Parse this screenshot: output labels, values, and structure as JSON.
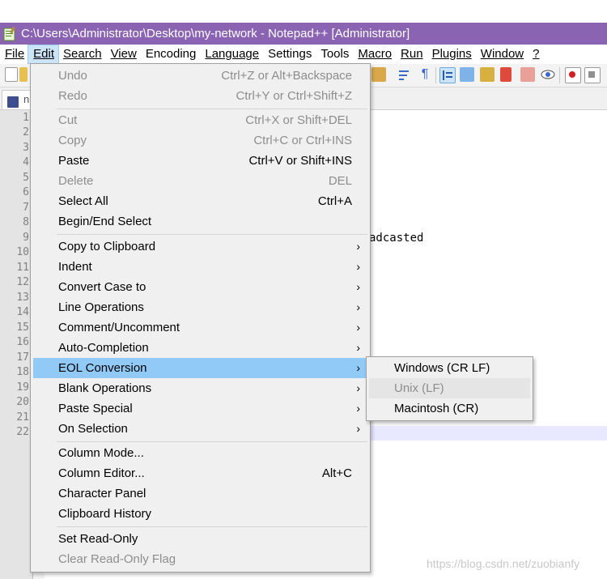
{
  "window": {
    "title": "C:\\Users\\Administrator\\Desktop\\my-network - Notepad++ [Administrator]"
  },
  "menubar": {
    "items": [
      {
        "label": "File",
        "key": "F"
      },
      {
        "label": "Edit",
        "key": "E"
      },
      {
        "label": "Search",
        "key": "S"
      },
      {
        "label": "View",
        "key": "V"
      },
      {
        "label": "Encoding",
        "key": "n"
      },
      {
        "label": "Language",
        "key": "L"
      },
      {
        "label": "Settings",
        "key": "t"
      },
      {
        "label": "Tools",
        "key": "o"
      },
      {
        "label": "Macro",
        "key": "M"
      },
      {
        "label": "Run",
        "key": "R"
      },
      {
        "label": "Plugins",
        "key": "P"
      },
      {
        "label": "Window",
        "key": "W"
      },
      {
        "label": "?",
        "key": "?"
      }
    ],
    "active": "Edit"
  },
  "tab": {
    "label_fragment": "n"
  },
  "editor": {
    "line_numbers": [
      "1",
      "2",
      "3",
      "4",
      "5",
      "6",
      "7",
      "8",
      "9",
      "10",
      "11",
      "12",
      "13",
      "14",
      "15",
      "16",
      "17",
      "18",
      "19",
      "20",
      "21",
      "22"
    ],
    "visible_text_line9": "adcasted",
    "current_line": 22
  },
  "edit_menu": {
    "items": [
      {
        "label": "Undo",
        "shortcut": "Ctrl+Z or Alt+Backspace",
        "disabled": true
      },
      {
        "label": "Redo",
        "shortcut": "Ctrl+Y or Ctrl+Shift+Z",
        "disabled": true
      },
      {
        "label": "Cut",
        "shortcut": "Ctrl+X or Shift+DEL",
        "disabled": true
      },
      {
        "label": "Copy",
        "shortcut": "Ctrl+C or Ctrl+INS",
        "disabled": true
      },
      {
        "label": "Paste",
        "shortcut": "Ctrl+V or Shift+INS",
        "disabled": false
      },
      {
        "label": "Delete",
        "shortcut": "DEL",
        "disabled": true
      },
      {
        "label": "Select All",
        "shortcut": "Ctrl+A",
        "disabled": false
      },
      {
        "label": "Begin/End Select",
        "shortcut": "",
        "disabled": false
      },
      {
        "label": "Copy to Clipboard",
        "submenu": true
      },
      {
        "label": "Indent",
        "submenu": true
      },
      {
        "label": "Convert Case to",
        "submenu": true
      },
      {
        "label": "Line Operations",
        "submenu": true
      },
      {
        "label": "Comment/Uncomment",
        "submenu": true
      },
      {
        "label": "Auto-Completion",
        "submenu": true
      },
      {
        "label": "EOL Conversion",
        "submenu": true,
        "highlighted": true
      },
      {
        "label": "Blank Operations",
        "submenu": true
      },
      {
        "label": "Paste Special",
        "submenu": true
      },
      {
        "label": "On Selection",
        "submenu": true
      },
      {
        "label": "Column Mode...",
        "shortcut": ""
      },
      {
        "label": "Column Editor...",
        "shortcut": "Alt+C"
      },
      {
        "label": "Character Panel",
        "shortcut": ""
      },
      {
        "label": "Clipboard History",
        "shortcut": ""
      },
      {
        "label": "Set Read-Only",
        "shortcut": ""
      },
      {
        "label": "Clear Read-Only Flag",
        "shortcut": "",
        "disabled": true
      }
    ],
    "submenu_arrow": "›"
  },
  "eol_submenu": {
    "items": [
      {
        "label": "Windows (CR LF)",
        "disabled": false
      },
      {
        "label": "Unix (LF)",
        "disabled": true
      },
      {
        "label": "Macintosh (CR)",
        "disabled": false
      }
    ]
  },
  "watermark": "https://blog.csdn.net/zuobianfy",
  "colors": {
    "titlebar": "#8a64b3",
    "menu_highlight": "#91c9f7",
    "menu_bg": "#f0f0f0"
  }
}
